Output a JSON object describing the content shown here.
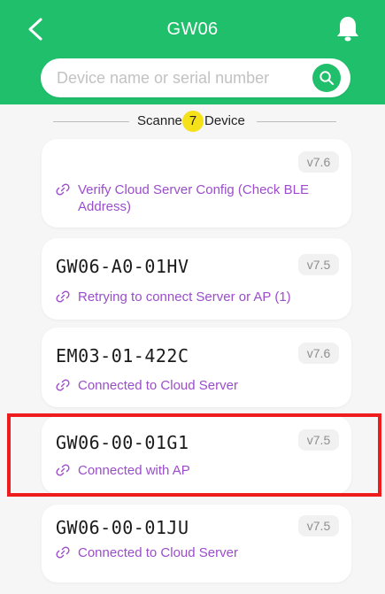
{
  "header": {
    "title": "GW06",
    "back_icon": "chevron-left-icon",
    "bell_icon": "bell-icon",
    "background_color": "#1fbf6b"
  },
  "search": {
    "placeholder": "Device name or serial number",
    "value": "",
    "icon": "search-icon"
  },
  "scanned": {
    "prefix": "Scanned",
    "count": "7",
    "suffix": "Device"
  },
  "devices": [
    {
      "name": "",
      "version": "v7.6",
      "status": "Verify Cloud Server Config (Check BLE Address)"
    },
    {
      "name": "GW06-A0-01HV",
      "version": "v7.5",
      "status": "Retrying to connect Server or AP (1)"
    },
    {
      "name": "EM03-01-422C",
      "version": "v7.6",
      "status": "Connected to Cloud Server"
    },
    {
      "name": "GW06-00-01G1",
      "version": "v7.5",
      "status": "Connected with AP",
      "highlighted": true
    },
    {
      "name": "GW06-00-01JU",
      "version": "v7.5",
      "status": "Connected to Cloud Server"
    }
  ],
  "colors": {
    "accent": "#1fbf6b",
    "status_text": "#9b4dcc",
    "badge_yellow": "#f5e11a",
    "highlight_border": "#ee1c1c"
  }
}
